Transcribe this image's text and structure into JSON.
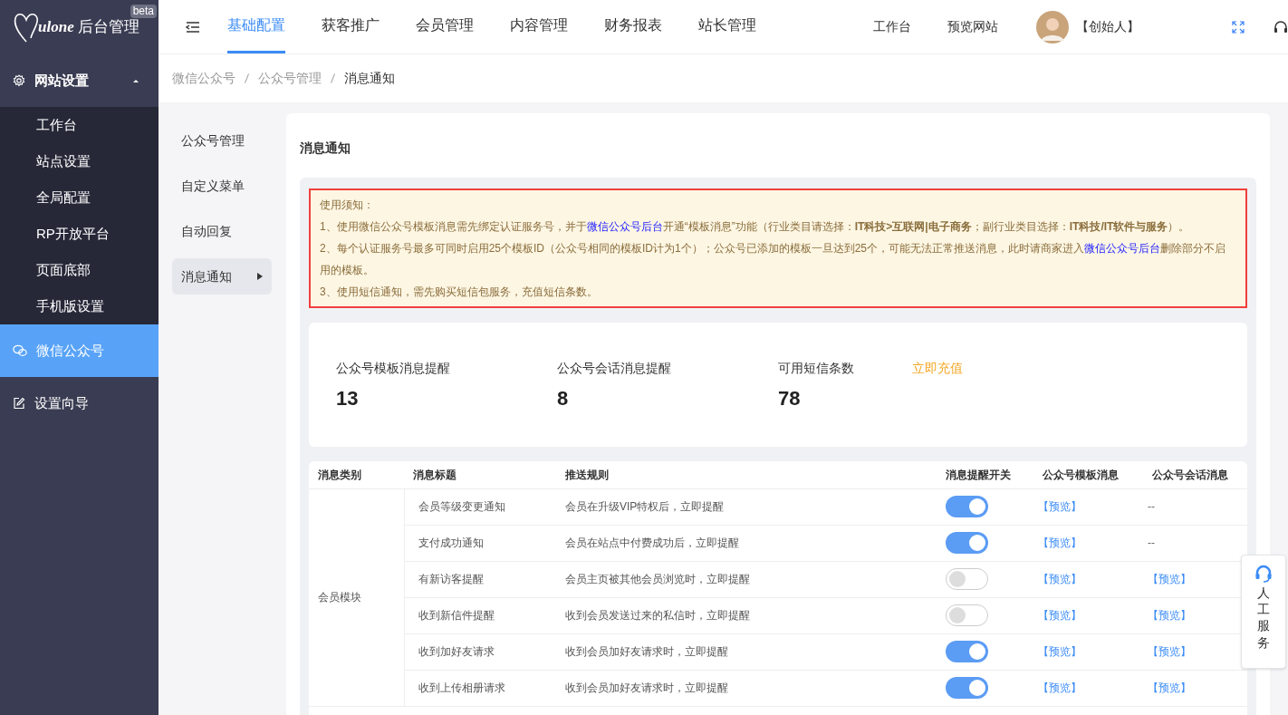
{
  "brand": {
    "logo_text": "ulone",
    "title": "后台管理",
    "badge": "beta"
  },
  "top_nav": [
    {
      "label": "基础配置",
      "selected": true
    },
    {
      "label": "获客推广",
      "selected": false
    },
    {
      "label": "会员管理",
      "selected": false
    },
    {
      "label": "内容管理",
      "selected": false
    },
    {
      "label": "财务报表",
      "selected": false
    },
    {
      "label": "站长管理",
      "selected": false
    }
  ],
  "top_links": [
    "工作台",
    "预览网站"
  ],
  "user": {
    "name": "【创始人】"
  },
  "sidebar": [
    {
      "label": "网站设置",
      "expanded": true,
      "selected": false,
      "children": [
        {
          "label": "工作台"
        },
        {
          "label": "站点设置"
        },
        {
          "label": "全局配置"
        },
        {
          "label": "RP开放平台"
        },
        {
          "label": "页面底部"
        },
        {
          "label": "手机版设置"
        }
      ]
    },
    {
      "label": "微信公众号",
      "selected": true
    },
    {
      "label": "设置向导",
      "selected": false
    }
  ],
  "breadcrumb": [
    "微信公众号",
    "公众号管理",
    "消息通知"
  ],
  "sub_menu": [
    {
      "label": "公众号管理",
      "selected": false
    },
    {
      "label": "自定义菜单",
      "selected": false
    },
    {
      "label": "自动回复",
      "selected": false
    },
    {
      "label": "消息通知",
      "selected": true
    }
  ],
  "page_title": "消息通知",
  "notice": {
    "heading": "使用须知：",
    "lines": [
      [
        {
          "kind": "text",
          "text": "1、使用微信公众号模板消息需先绑定认证服务号，并于"
        },
        {
          "kind": "link",
          "text": "微信公众号后台"
        },
        {
          "kind": "text",
          "text": "开通“模板消息”功能（行业类目请选择：**IT科技>互联网|电子商务**；副行业类目选择：**IT科技/IT软件与服务**）。"
        }
      ],
      [
        {
          "kind": "text",
          "text": "2、每个认证服务号最多可同时启用25个模板ID（公众号相同的模板ID计为1个）；公众号已添加的模板一旦达到25个，可能无法正常推送消息，此时请商家进入"
        },
        {
          "kind": "link",
          "text": "微信公众号后台"
        },
        {
          "kind": "text",
          "text": "删除部分不启用的模板。"
        }
      ],
      [
        {
          "kind": "text",
          "text": "3、使用短信通知，需先购买短信包服务，充值短信条数。"
        }
      ]
    ]
  },
  "stats": [
    {
      "label": "公众号模板消息提醒",
      "value": "13"
    },
    {
      "label": "公众号会话消息提醒",
      "value": "8"
    },
    {
      "label": "可用短信条数",
      "value": "78"
    }
  ],
  "recharge_link": "立即充值",
  "table": {
    "columns": [
      "消息类别",
      "消息标题",
      "推送规则",
      "消息提醒开关",
      "公众号模板消息",
      "公众号会话消息"
    ],
    "category": "会员模块",
    "rows": [
      {
        "title": "会员等级变更通知",
        "rule": "会员在升级VIP特权后，立即提醒",
        "on": true,
        "template": {
          "kind": "link",
          "text": "【预览】"
        },
        "session": {
          "kind": "text",
          "text": "--"
        }
      },
      {
        "title": "支付成功通知",
        "rule": "会员在站点中付费成功后，立即提醒",
        "on": true,
        "template": {
          "kind": "link",
          "text": "【预览】"
        },
        "session": {
          "kind": "text",
          "text": "--"
        }
      },
      {
        "title": "有新访客提醒",
        "rule": "会员主页被其他会员浏览时，立即提醒",
        "on": false,
        "template": {
          "kind": "link",
          "text": "【预览】"
        },
        "session": {
          "kind": "link",
          "text": "【预览】"
        }
      },
      {
        "title": "收到新信件提醒",
        "rule": "收到会员发送过来的私信时，立即提醒",
        "on": false,
        "template": {
          "kind": "link",
          "text": "【预览】"
        },
        "session": {
          "kind": "link",
          "text": "【预览】"
        }
      },
      {
        "title": "收到加好友请求",
        "rule": "收到会员加好友请求时，立即提醒",
        "on": true,
        "template": {
          "kind": "link",
          "text": "【预览】"
        },
        "session": {
          "kind": "link",
          "text": "【预览】"
        }
      },
      {
        "title": "收到上传相册请求",
        "rule": "收到会员加好友请求时，立即提醒",
        "on": true,
        "template": {
          "kind": "link",
          "text": "【预览】"
        },
        "session": {
          "kind": "link",
          "text": "【预览】"
        }
      }
    ]
  },
  "service_widget": {
    "label": "人工服务"
  }
}
